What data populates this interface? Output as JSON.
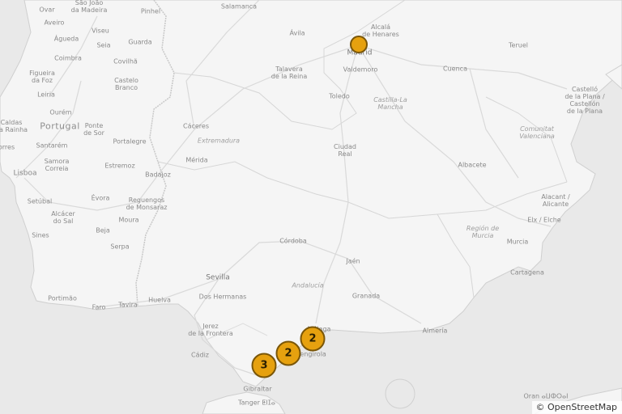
{
  "attribution": {
    "symbol": "©",
    "text": "OpenStreetMap"
  },
  "markers": [
    {
      "label": "",
      "cluster": false
    },
    {
      "label": "2",
      "cluster": true
    },
    {
      "label": "2",
      "cluster": true
    },
    {
      "label": "3",
      "cluster": true
    }
  ],
  "labels": {
    "ovar": "Ovar",
    "sao_joao": "São João\nda Madeira",
    "pinhel": "Pinhel",
    "salamanca": "Salamanca",
    "aveiro": "Aveiro",
    "viseu": "Viseu",
    "guarda": "Guarda",
    "agueda": "Águeda",
    "seia": "Seia",
    "avila": "Ávila",
    "alcala": "Alcalá\nde Henares",
    "madrid": "Madrid",
    "teruel": "Teruel",
    "coimbra": "Coimbra",
    "covilha": "Covilhã",
    "figueira": "Figueira\nda Foz",
    "castelo_branco": "Castelo\nBranco",
    "talavera": "Talavera\nde la Reina",
    "valdemoro": "Valdemoro",
    "cuenca": "Cuenca",
    "castello": "Castelló\nde la Plana /\nCastellón\nde la Plana",
    "leiria": "Leiria",
    "ourem": "Ourém",
    "toledo": "Toledo",
    "castilla": "Castilla-La\nMancha",
    "caldas": "Caldas\nda Rainha",
    "portugal": "Portugal",
    "ponte": "Ponte\nde Sor",
    "caceres": "Cáceres",
    "comunitat": "Comunitat\nValenciana",
    "torres": "orres",
    "santarem": "Santarém",
    "portalegre": "Portalegre",
    "extremadura": "Extremadura",
    "ciudad_real": "Ciudad\nReal",
    "samora": "Samora\nCorreia",
    "estremoz": "Estremoz",
    "merida": "Mérida",
    "albacete": "Albacete",
    "badajoz": "Badajoz",
    "lisboa": "Lisboa",
    "evora": "Évora",
    "reguengos": "Reguengos\nde Monsaraz",
    "alacant": "Alacant /\nAlicante",
    "setubal": "Setúbal",
    "alcacer": "Alcácer\ndo Sal",
    "moura": "Moura",
    "elx": "Elx / Elche",
    "beja": "Beja",
    "sines": "Sines",
    "region_murcia": "Región de\nMurcia",
    "cordoba": "Córdoba",
    "serpa": "Serpa",
    "murcia": "Murcia",
    "jaen": "Jaén",
    "cartagena": "Cartagena",
    "sevilla": "Sevilla",
    "andalucia": "Andalucía",
    "dos_hermanas": "Dos Hermanas",
    "granada": "Granada",
    "portimao": "Portimão",
    "faro": "Faro",
    "tavira": "Tavira",
    "huelva": "Huelva",
    "malaga": "Málaga",
    "jerez": "Jerez\nde la Frontera",
    "almeria": "Almería",
    "cadiz": "Cádiz",
    "fuengirola": "Fuengirola",
    "gibraltar": "Gibraltar",
    "oran": "Oran ⴰⵡⵀⵔⴰⵏ",
    "tanger": "Tanger ⵟⵏⵊⴰ"
  },
  "colors": {
    "land": "#f5f5f5",
    "sea": "#e9e9e9",
    "marker": "#e6a10f",
    "marker_border": "#7a5608"
  }
}
